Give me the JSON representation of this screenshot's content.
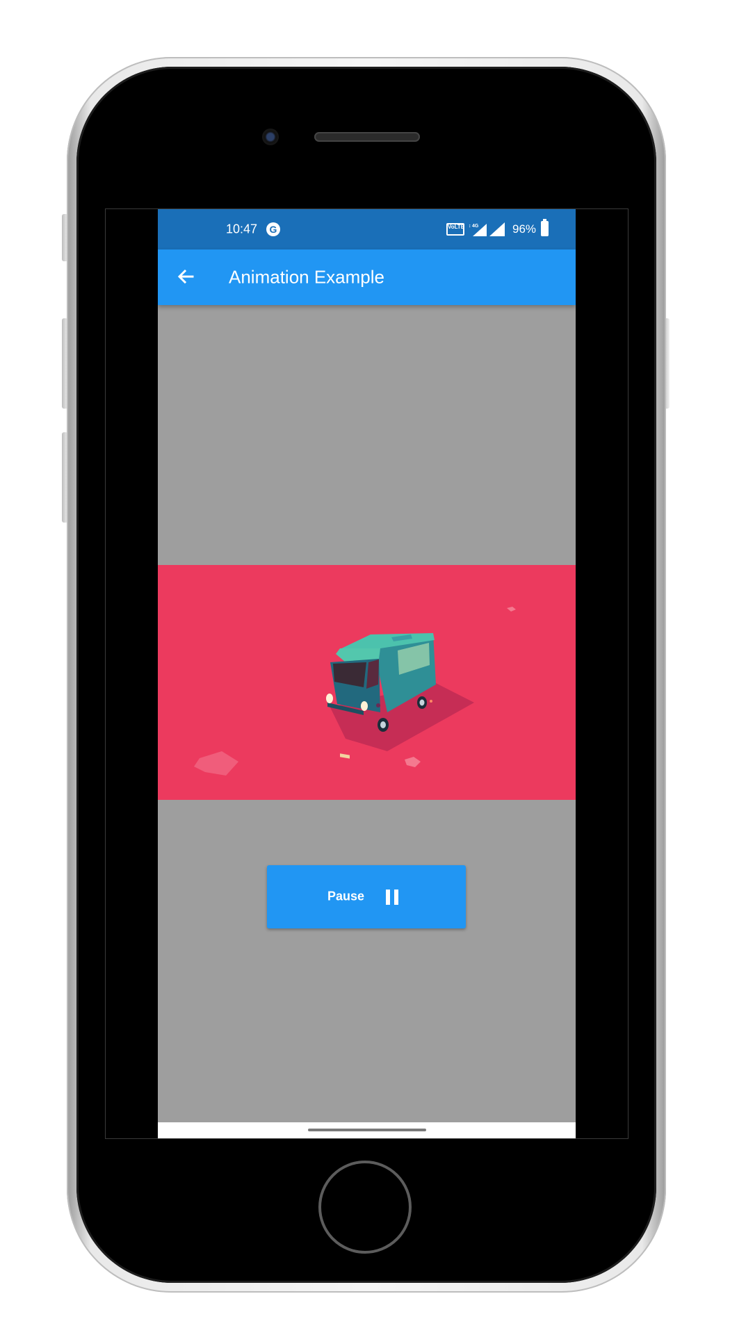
{
  "status_bar": {
    "time": "10:47",
    "google_icon": "G",
    "volte_icon": "Vo LTE",
    "battery_percent": "96%",
    "icons": [
      "google-icon",
      "volte-icon",
      "4g-signal-icon",
      "cell-signal-icon",
      "battery-icon"
    ]
  },
  "app_bar": {
    "title": "Animation Example",
    "back_icon": "arrow-back-icon"
  },
  "animation": {
    "subject": "isometric van illustration"
  },
  "controls": {
    "pause_label": "Pause",
    "pause_icon": "pause-icon"
  },
  "colors": {
    "status_bar": "#1a6fb8",
    "app_bar": "#2196f3",
    "background": "#9e9e9e",
    "animation_panel": "#ec3a5e",
    "button": "#2196f3"
  }
}
